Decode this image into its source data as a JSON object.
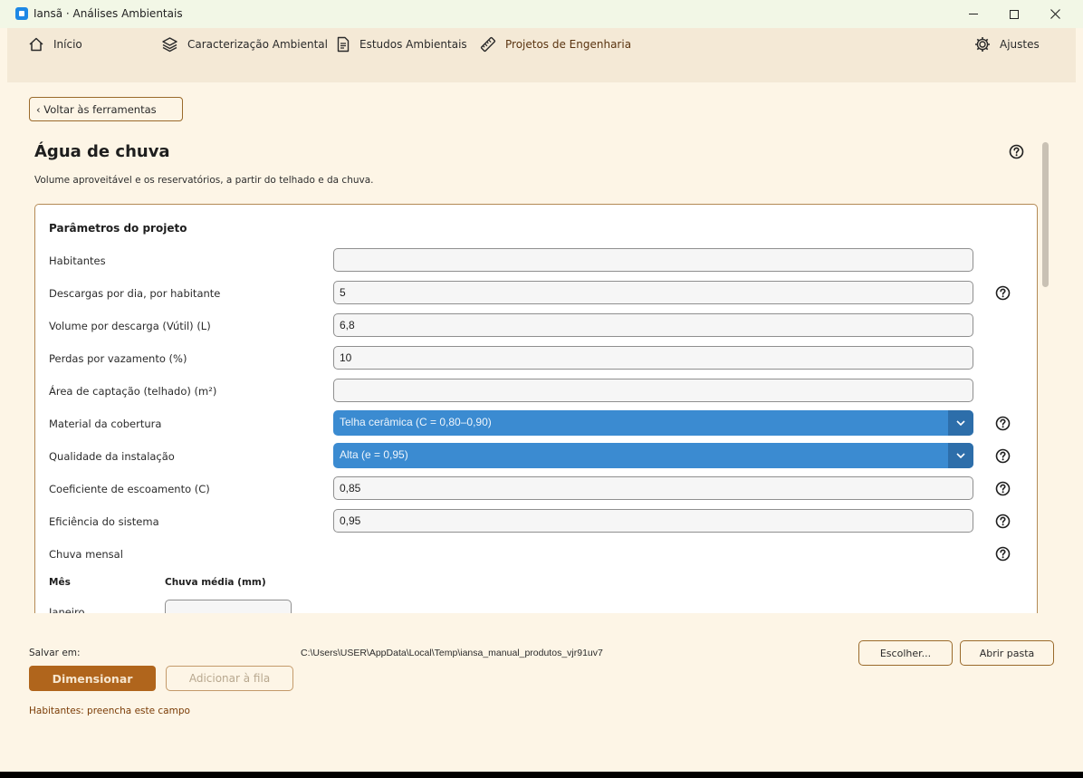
{
  "window": {
    "title": "Iansã · Análises Ambientais"
  },
  "nav": {
    "inicio": "Início",
    "caracterizacao": "Caracterização Ambiental",
    "estudos": "Estudos Ambientais",
    "projetos": "Projetos de Engenharia",
    "ajustes": "Ajustes"
  },
  "back_button": "‹ Voltar às ferramentas",
  "page": {
    "title": "Água de chuva",
    "subtitle": "Volume aproveitável e os reservatórios, a partir do telhado e da chuva."
  },
  "panel": {
    "title": "Parâmetros do projeto",
    "fields": [
      {
        "label": "Habitantes",
        "value": ""
      },
      {
        "label": "Descargas por dia, por habitante",
        "value": "5"
      },
      {
        "label": "Volume por descarga (Vútil) (L)",
        "value": "6,8"
      },
      {
        "label": "Perdas por vazamento (%)",
        "value": "10"
      },
      {
        "label": "Área de captação (telhado) (m²)",
        "value": ""
      },
      {
        "label": "Material da cobertura",
        "value": "Telha cerâmica (C = 0,80–0,90)"
      },
      {
        "label": "Qualidade da instalação",
        "value": "Alta (e = 0,95)"
      },
      {
        "label": "Coeficiente de escoamento (C)",
        "value": "0,85"
      },
      {
        "label": "Eficiência do sistema",
        "value": "0,95"
      },
      {
        "label": "Chuva mensal"
      }
    ],
    "table": {
      "col_month": "Mês",
      "col_rain": "Chuva média (mm)",
      "first_month": "Janeiro"
    }
  },
  "footer": {
    "save_label": "Salvar em:",
    "save_path": "C:\\Users\\USER\\AppData\\Local\\Temp\\iansa_manual_produtos_vjr91uv7",
    "choose_button": "Escolher...",
    "open_folder_button": "Abrir pasta",
    "dimension_button": "Dimensionar",
    "queue_button": "Adicionar à fila",
    "status": "Habitantes: preencha este campo"
  },
  "colors": {
    "background": "#fdf5e6",
    "nav_background": "#f4e9d6",
    "accent": "#b0651c",
    "select_blue": "#3b8bd1",
    "error_text": "#7b3c06"
  }
}
